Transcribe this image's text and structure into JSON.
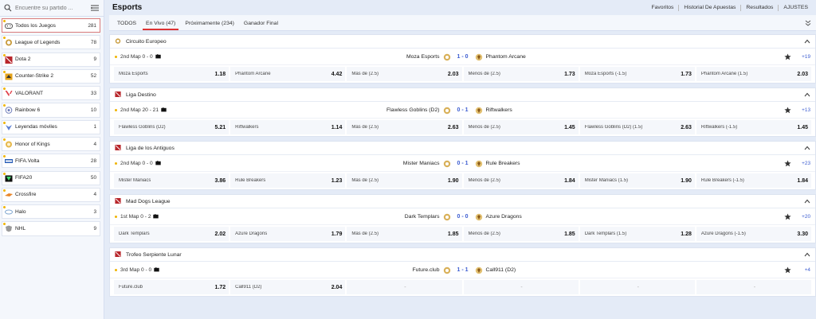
{
  "search": {
    "placeholder": "Encuentre su partido ..."
  },
  "sidebar": {
    "items": [
      {
        "label": "Todos los Juegos",
        "count": "281",
        "icon": "gamepad-icon",
        "active": true
      },
      {
        "label": "League of Legends",
        "count": "78",
        "icon": "lol-icon"
      },
      {
        "label": "Dota 2",
        "count": "9",
        "icon": "dota2-icon"
      },
      {
        "label": "Counter-Strike 2",
        "count": "52",
        "icon": "cs2-icon"
      },
      {
        "label": "VALORANT",
        "count": "33",
        "icon": "valorant-icon"
      },
      {
        "label": "Rainbow 6",
        "count": "10",
        "icon": "rainbow6-icon"
      },
      {
        "label": "Leyendas móviles",
        "count": "1",
        "icon": "mobile-legends-icon"
      },
      {
        "label": "Honor of Kings",
        "count": "4",
        "icon": "honor-of-kings-icon"
      },
      {
        "label": "FIFA.Volta",
        "count": "28",
        "icon": "fifa-volta-icon"
      },
      {
        "label": "FIFA20",
        "count": "50",
        "icon": "fifa20-icon"
      },
      {
        "label": "Crossfire",
        "count": "4",
        "icon": "crossfire-icon"
      },
      {
        "label": "Halo",
        "count": "3",
        "icon": "halo-icon"
      },
      {
        "label": "NHL",
        "count": "9",
        "icon": "nhl-icon"
      }
    ]
  },
  "header": {
    "title": "Esports",
    "links": [
      "Favoritos",
      "Historial De Apuestas",
      "Resultados",
      "AJUSTES"
    ]
  },
  "tabs": [
    "TODOS",
    "En Vivo (47)",
    "Próximamente (234)",
    "Ganador Final"
  ],
  "active_tab": 1,
  "leagues": [
    {
      "name": "Circuito Europeo",
      "icon": "lol-icon",
      "map": "2nd Map 0 - 0",
      "team_a": "Moza Esports",
      "score": "1 - 0",
      "team_b": "Phantom Arcane",
      "more": "+19",
      "odds": [
        {
          "label": "Moza Esports",
          "value": "1.18"
        },
        {
          "label": "Phantom Arcane",
          "value": "4.42"
        },
        {
          "label": "Más de (2.5)",
          "value": "2.03"
        },
        {
          "label": "Menos de (2.5)",
          "value": "1.73"
        },
        {
          "label": "Moza Esports (-1.5)",
          "value": "1.73"
        },
        {
          "label": "Phantom Arcane (1.5)",
          "value": "2.03"
        }
      ]
    },
    {
      "name": "Liga Destino",
      "icon": "dota2-icon",
      "map": "2nd Map 20 - 21",
      "team_a": "Flawless Goblins (D2)",
      "score": "0 - 1",
      "team_b": "Riftwalkers",
      "more": "+13",
      "odds": [
        {
          "label": "Flawless Goblins (D2)",
          "value": "5.21"
        },
        {
          "label": "Riftwalkers",
          "value": "1.14"
        },
        {
          "label": "Más de (2.5)",
          "value": "2.63"
        },
        {
          "label": "Menos de (2.5)",
          "value": "1.45"
        },
        {
          "label": "Flawless Goblins (D2) (1.5)",
          "value": "2.63"
        },
        {
          "label": "Riftwalkers (-1.5)",
          "value": "1.45"
        }
      ]
    },
    {
      "name": "Liga de los Antiguos",
      "icon": "dota2-icon",
      "map": "2nd Map 0 - 0",
      "team_a": "Mister Maniacs",
      "score": "0 - 1",
      "team_b": "Rule Breakers",
      "more": "+23",
      "odds": [
        {
          "label": "Mister Maniacs",
          "value": "3.86"
        },
        {
          "label": "Rule Breakers",
          "value": "1.23"
        },
        {
          "label": "Más de (2.5)",
          "value": "1.90"
        },
        {
          "label": "Menos de (2.5)",
          "value": "1.84"
        },
        {
          "label": "Mister Maniacs (1.5)",
          "value": "1.90"
        },
        {
          "label": "Rule Breakers (-1.5)",
          "value": "1.84"
        }
      ]
    },
    {
      "name": "Mad Dogs League",
      "icon": "dota2-icon",
      "map": "1st Map 0 - 2",
      "team_a": "Dark Templars",
      "score": "0 - 0",
      "team_b": "Azure Dragons",
      "more": "+20",
      "odds": [
        {
          "label": "Dark Templars",
          "value": "2.02"
        },
        {
          "label": "Azure Dragons",
          "value": "1.79"
        },
        {
          "label": "Más de (2.5)",
          "value": "1.85"
        },
        {
          "label": "Menos de (2.5)",
          "value": "1.85"
        },
        {
          "label": "Dark Templars (1.5)",
          "value": "1.28"
        },
        {
          "label": "Azure Dragons (-1.5)",
          "value": "3.30"
        }
      ]
    },
    {
      "name": "Trofeo Serpiente Lunar",
      "icon": "dota2-icon",
      "map": "3rd Map 0 - 0",
      "team_a": "Future.club",
      "score": "1 - 1",
      "team_b": "Call911 (D2)",
      "more": "+4",
      "odds": [
        {
          "label": "Future.club",
          "value": "1.72"
        },
        {
          "label": "Call911 (D2)",
          "value": "2.04"
        },
        {
          "label": "",
          "value": "-"
        },
        {
          "label": "",
          "value": "-"
        },
        {
          "label": "",
          "value": "-"
        },
        {
          "label": "",
          "value": "-"
        }
      ]
    }
  ],
  "colors": {
    "accent": "#d33333",
    "score_blue": "#3a5bd0",
    "page_bg": "#e4ebf7"
  }
}
